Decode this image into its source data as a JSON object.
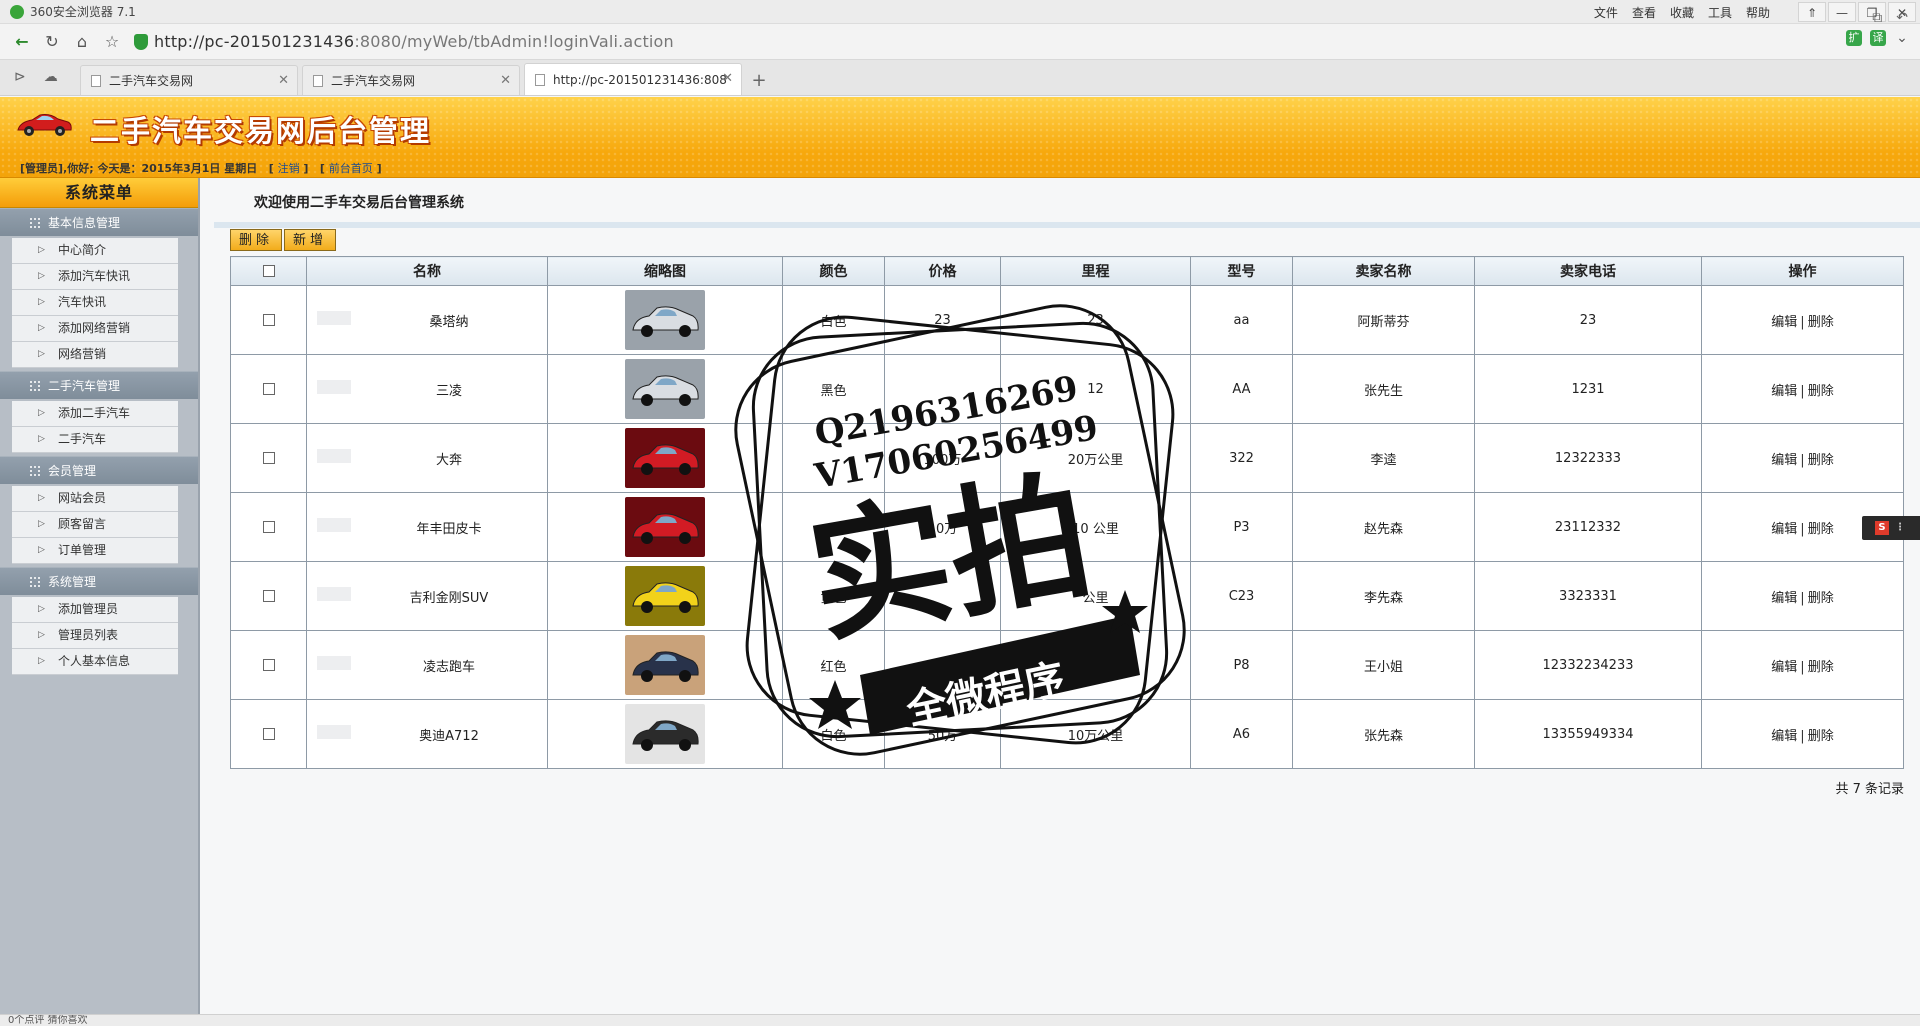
{
  "browser": {
    "window_title": "360安全浏览器 7.1",
    "menu": [
      "文件",
      "查看",
      "收藏",
      "工具",
      "帮助"
    ],
    "url_host": "http://pc-201501231436",
    "url_rest": ":8080/myWeb/tbAdmin!loginVali.action",
    "tabs": [
      {
        "label": "二手汽车交易网",
        "active": false
      },
      {
        "label": "二手汽车交易网",
        "active": false
      },
      {
        "label": "http://pc-201501231436:808",
        "active": true
      }
    ],
    "status_left": "0个点评    猜你喜欢"
  },
  "header": {
    "title": "二手汽车交易网后台管理",
    "info_prefix": "[管理员],你好; 今天是：2015年3月1日 星期日",
    "logout_link": "注销",
    "home_link": "前台首页"
  },
  "sidebar": {
    "title": "系统菜单",
    "groups": [
      {
        "label": "基本信息管理",
        "items": [
          "中心简介",
          "添加汽车快讯",
          "汽车快讯",
          "添加网络营销",
          "网络营销"
        ]
      },
      {
        "label": "二手汽车管理",
        "items": [
          "添加二手汽车",
          "二手汽车"
        ]
      },
      {
        "label": "会员管理",
        "items": [
          "网站会员",
          "顾客留言",
          "订单管理"
        ]
      },
      {
        "label": "系统管理",
        "items": [
          "添加管理员",
          "管理员列表",
          "个人基本信息"
        ]
      }
    ]
  },
  "main": {
    "welcome": "欢迎使用二手车交易后台管理系统",
    "delete_button": "删除",
    "add_button": "新增",
    "columns": [
      "名称",
      "缩略图",
      "颜色",
      "价格",
      "里程",
      "型号",
      "卖家名称",
      "卖家电话",
      "操作"
    ],
    "rows": [
      {
        "name": "桑塔纳",
        "color": "白色",
        "price": "23",
        "mileage": "23",
        "model": "aa",
        "seller": "阿斯蒂芬",
        "phone": "23",
        "thumb": "silver"
      },
      {
        "name": "三凌",
        "color": "黑色",
        "price": "",
        "mileage": "12",
        "model": "AA",
        "seller": "张先生",
        "phone": "1231",
        "thumb": "silver"
      },
      {
        "name": "大奔",
        "color": "",
        "price": "100万",
        "mileage": "20万公里",
        "model": "322",
        "seller": "李逵",
        "phone": "12322333",
        "thumb": "red"
      },
      {
        "name": "年丰田皮卡",
        "color": "",
        "price": "10万",
        "mileage": "10 公里",
        "model": "P3",
        "seller": "赵先森",
        "phone": "23112332",
        "thumb": "red"
      },
      {
        "name": "吉利金刚SUV",
        "color": "黄色",
        "price": "",
        "mileage": "公里",
        "model": "C23",
        "seller": "李先森",
        "phone": "3323331",
        "thumb": "yellow"
      },
      {
        "name": "凌志跑车",
        "color": "红色",
        "price": "",
        "mileage": "20000公里",
        "model": "P8",
        "seller": "王小姐",
        "phone": "12332234233",
        "thumb": "dark"
      },
      {
        "name": "奥迪A712",
        "color": "白色",
        "price": "50万",
        "mileage": "10万公里",
        "model": "A6",
        "seller": "张先森",
        "phone": "13355949334",
        "thumb": "black"
      }
    ],
    "edit_label": "编辑",
    "remove_label": "删除",
    "action_sep": "|",
    "record_count": "共 7 条记录"
  },
  "watermark": {
    "line1": "Q2196316269",
    "line2": "V17060256499",
    "big": "实拍",
    "ribbon": "全微程序"
  },
  "colors": {
    "header_orange": "#f7a80c",
    "sidebar_gray": "#b7bec6",
    "link_blue": "#1d4f91"
  }
}
